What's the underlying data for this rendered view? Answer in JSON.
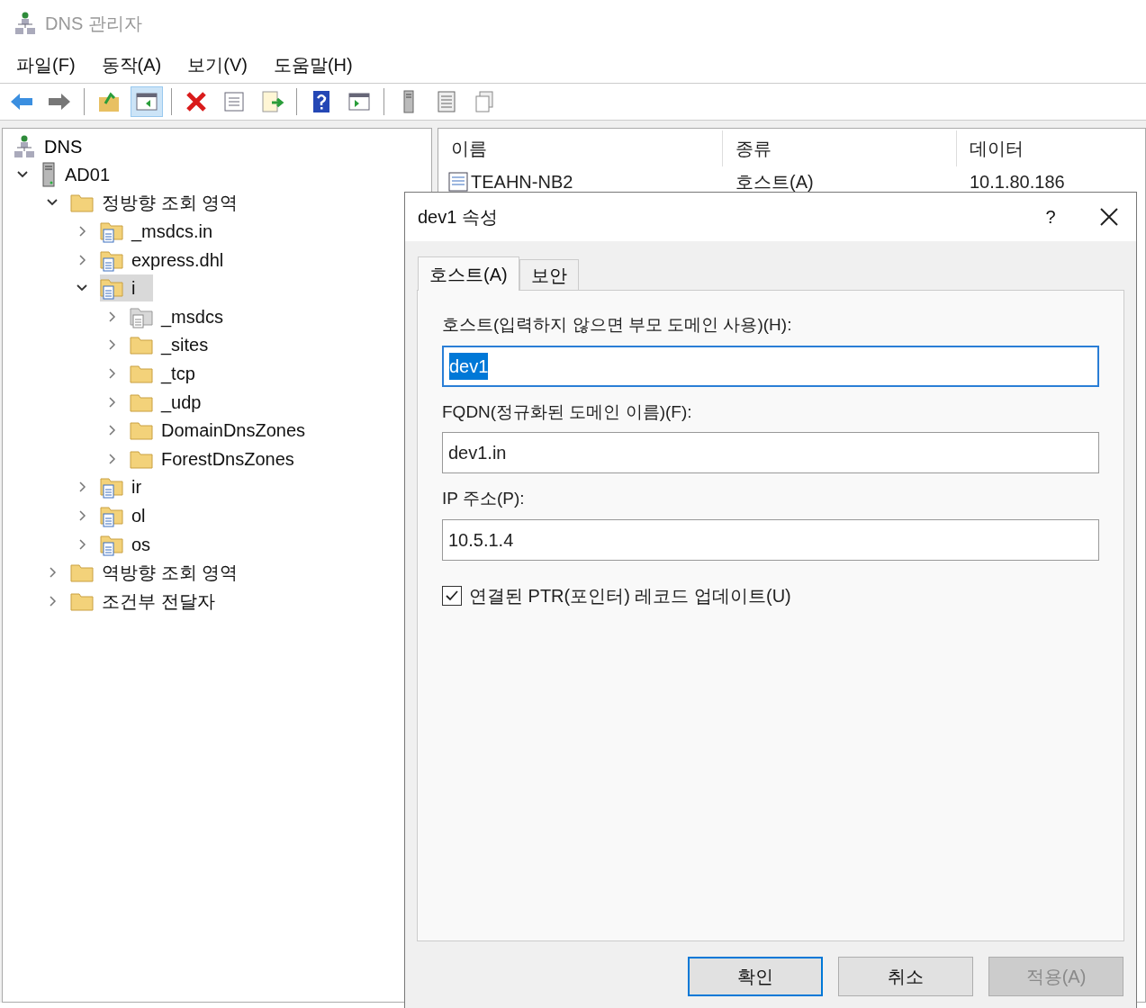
{
  "window": {
    "title": "DNS 관리자"
  },
  "menu": [
    "파일(F)",
    "동작(A)",
    "보기(V)",
    "도움말(H)"
  ],
  "toolbar": [
    {
      "kind": "back",
      "pressed": false
    },
    {
      "kind": "forward",
      "pressed": false
    },
    {
      "kind": "separator"
    },
    {
      "kind": "up-folder",
      "pressed": false
    },
    {
      "kind": "console-tree",
      "pressed": true
    },
    {
      "kind": "separator"
    },
    {
      "kind": "delete",
      "pressed": false
    },
    {
      "kind": "properties",
      "pressed": false
    },
    {
      "kind": "export",
      "pressed": false
    },
    {
      "kind": "separator"
    },
    {
      "kind": "help",
      "pressed": false
    },
    {
      "kind": "action-pane",
      "pressed": false
    },
    {
      "kind": "separator"
    },
    {
      "kind": "server",
      "pressed": false
    },
    {
      "kind": "list",
      "pressed": false
    },
    {
      "kind": "copy",
      "pressed": false
    }
  ],
  "tree": [
    {
      "label": "DNS",
      "kind": "dns",
      "selected": false,
      "children": [
        {
          "label": "AD01",
          "kind": "server",
          "expanded": true,
          "selected": false,
          "children": [
            {
              "label": "정방향 조회 영역",
              "kind": "folder",
              "expanded": true,
              "selected": false,
              "children": [
                {
                  "label": "_msdcs.in",
                  "kind": "zone",
                  "expanded": false,
                  "selected": false
                },
                {
                  "label": "express.dhl",
                  "kind": "zone",
                  "expanded": false,
                  "selected": false
                },
                {
                  "label": "i",
                  "kind": "zone",
                  "expanded": true,
                  "selected": true,
                  "children": [
                    {
                      "label": "_msdcs",
                      "kind": "zone-gray",
                      "expanded": false,
                      "selected": false
                    },
                    {
                      "label": "_sites",
                      "kind": "folder",
                      "expanded": false,
                      "selected": false
                    },
                    {
                      "label": "_tcp",
                      "kind": "folder",
                      "expanded": false,
                      "selected": false
                    },
                    {
                      "label": "_udp",
                      "kind": "folder",
                      "expanded": false,
                      "selected": false
                    },
                    {
                      "label": "DomainDnsZones",
                      "kind": "folder",
                      "expanded": false,
                      "selected": false
                    },
                    {
                      "label": "ForestDnsZones",
                      "kind": "folder",
                      "expanded": false,
                      "selected": false
                    }
                  ]
                },
                {
                  "label": "ir",
                  "kind": "zone",
                  "expanded": false,
                  "selected": false
                },
                {
                  "label": "ol",
                  "kind": "zone",
                  "expanded": false,
                  "selected": false
                },
                {
                  "label": "os",
                  "kind": "zone",
                  "expanded": false,
                  "selected": false
                }
              ]
            },
            {
              "label": "역방향 조회 영역",
              "kind": "folder",
              "expanded": false,
              "selected": false
            },
            {
              "label": "조건부 전달자",
              "kind": "folder",
              "expanded": false,
              "selected": false
            }
          ]
        }
      ]
    }
  ],
  "list": {
    "columns": [
      "이름",
      "종류",
      "데이터"
    ],
    "rows": [
      {
        "cells": [
          "TEAHN-NB2",
          "호스트(A)",
          "10.1.80.186"
        ]
      }
    ]
  },
  "dialog": {
    "title": "dev1 속성",
    "help": "?",
    "tabs": [
      {
        "label": "호스트(A)",
        "selected": true
      },
      {
        "label": "보안",
        "selected": false
      }
    ],
    "fields": [
      {
        "label": "호스트(입력하지 않으면 부모 도메인 사용)(H):",
        "value": "dev1",
        "focused": true
      },
      {
        "label": "FQDN(정규화된 도메인 이름)(F):",
        "value": "dev1.in",
        "focused": false
      },
      {
        "label": "IP 주소(P):",
        "value": "10.5.1.4",
        "focused": false
      }
    ],
    "checkbox": {
      "label": "연결된 PTR(포인터) 레코드 업데이트(U)",
      "checked": true
    },
    "buttons": [
      {
        "label": "확인",
        "default": true,
        "disabled": false
      },
      {
        "label": "취소",
        "default": false,
        "disabled": false
      },
      {
        "label": "적용(A)",
        "default": false,
        "disabled": true
      }
    ]
  }
}
